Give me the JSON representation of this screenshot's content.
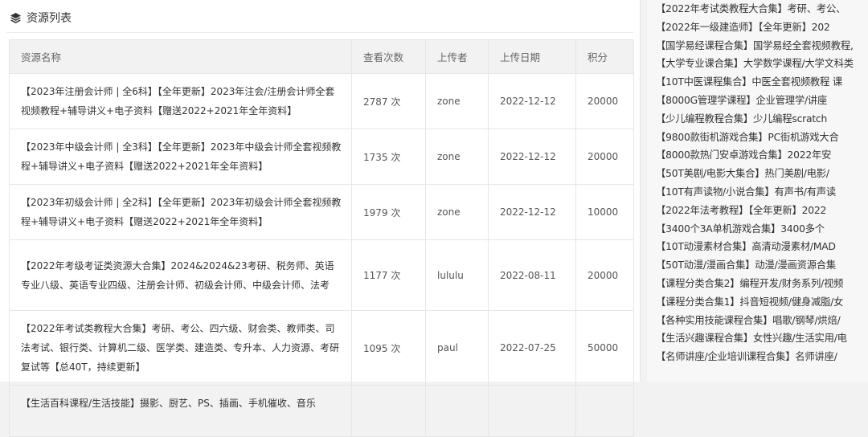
{
  "panel": {
    "title": "资源列表",
    "icon": "layers-icon"
  },
  "table": {
    "headers": {
      "name": "资源名称",
      "views": "查看次数",
      "uploader": "上传者",
      "date": "上传日期",
      "points": "积分"
    },
    "rows": [
      {
        "name": "【2023年注册会计师 | 全6科】【全年更新】2023年注会/注册会计师全套视频教程+辅导讲义+电子资料【赠送2022+2021年全年资料】",
        "views": "2787 次",
        "uploader": "zone",
        "date": "2022-12-12",
        "points": "20000"
      },
      {
        "name": "【2023年中级会计师 | 全3科】【全年更新】2023年中级会计师全套视频教程+辅导讲义+电子资料【赠送2022+2021年全年资料】",
        "views": "1735 次",
        "uploader": "zone",
        "date": "2022-12-12",
        "points": "20000"
      },
      {
        "name": "【2023年初级会计师 | 全2科】【全年更新】2023年初级会计师全套视频教程+辅导讲义+电子资料【赠送2022+2021年全年资料】",
        "views": "1979 次",
        "uploader": "zone",
        "date": "2022-12-12",
        "points": "10000"
      },
      {
        "name": "【2022年考级考证类资源大合集】2024&2024&23考研、税务师、英语专业八级、英语专业四级、注册会计师、初级会计师、中级会计师、法考",
        "views": "1177 次",
        "uploader": "lululu",
        "date": "2022-08-11",
        "points": "20000"
      },
      {
        "name": "【2022年考试类教程大合集】考研、考公、四六级、财会类、教师类、司法考试、银行类、计算机二级、医学类、建造类、专升本、人力资源、考研复试等【总40T，持续更新】",
        "views": "1095 次",
        "uploader": "paul",
        "date": "2022-07-25",
        "points": "50000"
      },
      {
        "name": "【生活百科课程/生活技能】摄影、厨艺、PS、插画、手机催收、音乐",
        "views": "",
        "uploader": "",
        "date": "",
        "points": ""
      }
    ]
  },
  "sidebar": {
    "items": [
      "【2022年考试类教程大合集】考研、考公、",
      "【2022年一级建造师】【全年更新】202",
      "【国学易经课程合集】国学易经全套视频教程,",
      "【大学专业课合集】大学数学课程/大学文科类",
      "【10T中医课程集合】中医全套视频教程 课",
      "【8000G管理学课程】企业管理学/讲座",
      "【少儿编程教程合集】少儿编程scratch",
      "【9800款街机游戏合集】PC街机游戏大合",
      "【8000款热门安卓游戏合集】2022年安",
      "【50T美剧/电影大集合】热门美剧/电影/",
      "【10T有声读物/小说合集】有声书/有声读",
      "【2022年法考教程】【全年更新】2022",
      "【3400个3A单机游戏合集】3400多个",
      "【10T动漫素材合集】高清动漫素材/MAD",
      "【50T动漫/漫画合集】动漫/漫画资源合集",
      "【课程分类合集2】编程开发/财务系列/视频",
      "【课程分类合集1】抖音短视频/健身减脂/女",
      "【各种实用技能课程合集】唱歌/钢琴/烘焙/",
      "【生活兴趣课程合集】女性兴趣/生活实用/电",
      "【名师讲座/企业培训课程合集】名师讲座/"
    ]
  }
}
